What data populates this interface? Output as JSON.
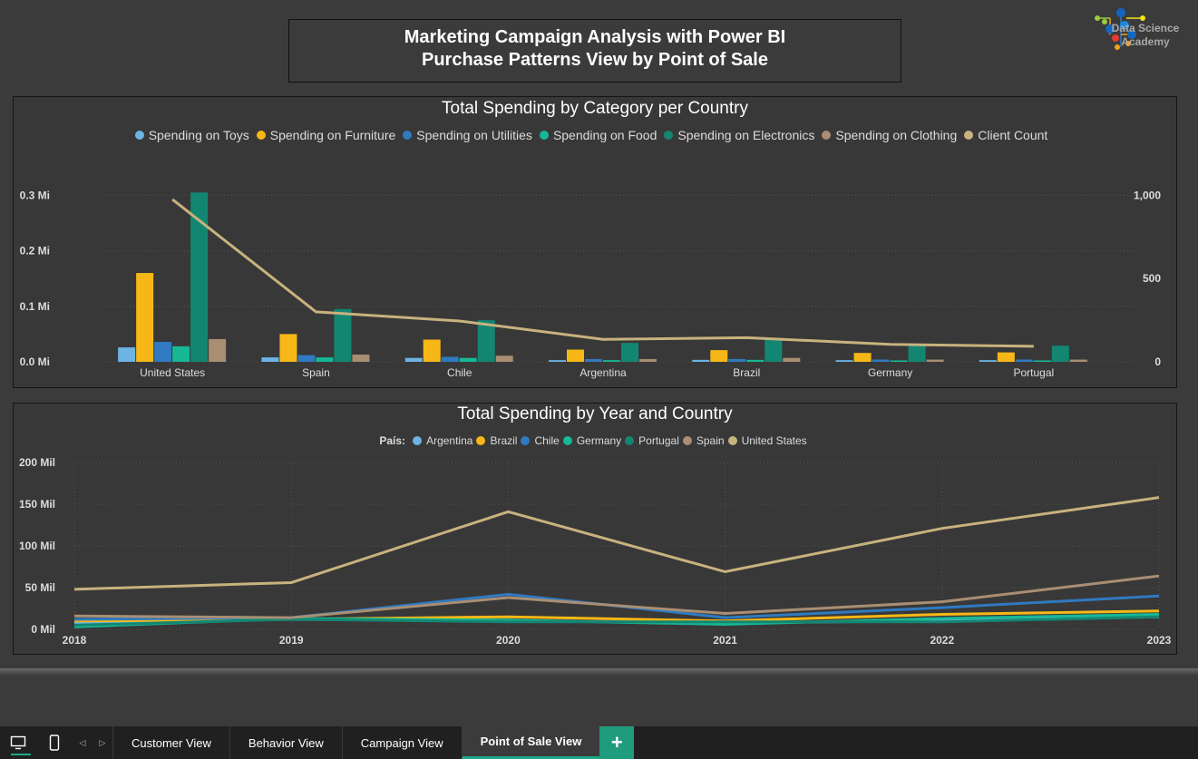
{
  "header": {
    "title_line1": "Marketing Campaign Analysis with Power BI",
    "title_line2": "Purchase Patterns View by Point of Sale"
  },
  "logo": {
    "line1": "Data Science",
    "line2": "Academy"
  },
  "chart_top_title": "Total Spending by Category per Country",
  "chart_bottom_title": "Total Spending by Year and Country",
  "chart_bottom_legend_label": "País:",
  "chart_data": [
    {
      "type": "bar",
      "title": "Total Spending by Category per Country",
      "categories": [
        "United States",
        "Spain",
        "Chile",
        "Argentina",
        "Brazil",
        "Germany",
        "Portugal"
      ],
      "series": [
        {
          "name": "Spending on Toys",
          "color": "#6cb4e4",
          "values": [
            26000,
            8000,
            7000,
            3000,
            3500,
            3000,
            3000
          ]
        },
        {
          "name": "Spending on Furniture",
          "color": "#f7b817",
          "values": [
            160000,
            50000,
            40000,
            22000,
            21000,
            16000,
            17000
          ]
        },
        {
          "name": "Spending on Utilities",
          "color": "#2f7ac0",
          "values": [
            36000,
            12000,
            9000,
            5000,
            5000,
            4000,
            4000
          ]
        },
        {
          "name": "Spending on Food",
          "color": "#16b895",
          "values": [
            28000,
            8000,
            7000,
            3000,
            3500,
            2500,
            2500
          ]
        },
        {
          "name": "Spending on Electronics",
          "color": "#138672",
          "values": [
            305000,
            95000,
            75000,
            34000,
            40000,
            31000,
            29000
          ]
        },
        {
          "name": "Spending on Clothing",
          "color": "#a98e73",
          "values": [
            41000,
            13000,
            11000,
            5000,
            7000,
            4000,
            4000
          ]
        }
      ],
      "line_series": {
        "name": "Client Count",
        "color": "#c8b27e",
        "values": [
          975,
          300,
          245,
          135,
          145,
          105,
          93
        ]
      },
      "y_ticks": [
        "0.0 Mi",
        "0.1 Mi",
        "0.2 Mi",
        "0.3 Mi"
      ],
      "y2_ticks": [
        "0",
        "500",
        "1,000"
      ],
      "ylim": [
        0,
        330000
      ],
      "y2lim": [
        0,
        1100
      ]
    },
    {
      "type": "line",
      "title": "Total Spending by Year and Country",
      "x": [
        "2018",
        "2019",
        "2020",
        "2021",
        "2022",
        "2023"
      ],
      "series": [
        {
          "name": "Argentina",
          "color": "#6cb4e4",
          "values": [
            8,
            12,
            10,
            8,
            10,
            15
          ]
        },
        {
          "name": "Brazil",
          "color": "#f7b817",
          "values": [
            10,
            12,
            15,
            10,
            18,
            22
          ]
        },
        {
          "name": "Chile",
          "color": "#2f7ac0",
          "values": [
            12,
            14,
            42,
            14,
            26,
            40
          ]
        },
        {
          "name": "Germany",
          "color": "#16b895",
          "values": [
            3,
            13,
            11,
            6,
            13,
            18
          ]
        },
        {
          "name": "Portugal",
          "color": "#138672",
          "values": [
            5,
            12,
            9,
            9,
            9,
            15
          ]
        },
        {
          "name": "Spain",
          "color": "#a98e73",
          "values": [
            16,
            14,
            38,
            19,
            33,
            64
          ]
        },
        {
          "name": "United States",
          "color": "#c8b27e",
          "values": [
            48,
            56,
            141,
            69,
            121,
            158
          ]
        }
      ],
      "y_ticks": [
        "0 Mil",
        "50 Mil",
        "100 Mil",
        "150 Mil",
        "200 Mil"
      ],
      "ylim": [
        0,
        200
      ]
    }
  ],
  "bottom_bar": {
    "tabs": [
      "Customer View",
      "Behavior View",
      "Campaign View",
      "Point of Sale View"
    ],
    "active_tab": "Point of Sale View",
    "add_label": "+"
  }
}
